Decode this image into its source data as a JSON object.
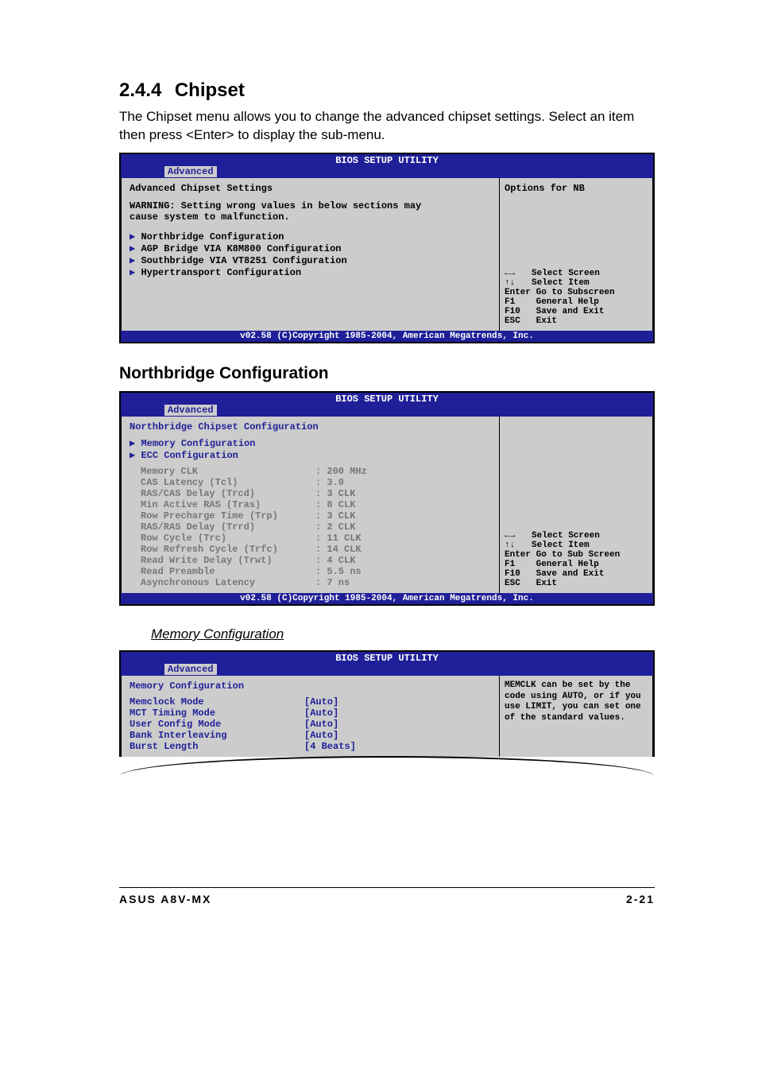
{
  "section": {
    "number": "2.4.4",
    "title": "Chipset"
  },
  "intro": "The Chipset menu allows you to change the advanced chipset settings. Select an item then press <Enter> to display the sub-menu.",
  "bios1": {
    "title": "BIOS SETUP UTILITY",
    "tab": "Advanced",
    "panel_title": "Advanced Chipset Settings",
    "warning1": "WARNING: Setting wrong values in below sections may",
    "warning2": "         cause system to malfunction.",
    "items": [
      "Northbridge Configuration",
      "AGP Bridge VIA K8M800 Configuration",
      "Southbridge VIA VT8251 Configuration",
      "Hypertransport Configuration"
    ],
    "help_top": "Options for NB",
    "nav": {
      "lr": "Select Screen",
      "ud": "Select Item",
      "enter": "Enter Go to Subscreen",
      "f1": "F1    General Help",
      "f10": "F10   Save and Exit",
      "esc": "ESC   Exit"
    },
    "footer": "v02.58 (C)Copyright 1985-2004, American Megatrends, Inc."
  },
  "nb_heading": "Northbridge Configuration",
  "bios2": {
    "title": "BIOS SETUP UTILITY",
    "tab": "Advanced",
    "panel_title": "Northbridge Chipset Configuration",
    "subitems": [
      "Memory Configuration",
      "ECC Configuration"
    ],
    "rows": [
      {
        "k": "Memory CLK",
        "v": ": 200 MHz"
      },
      {
        "k": "CAS Latency (Tcl)",
        "v": ": 3.0"
      },
      {
        "k": "RAS/CAS Delay (Trcd)",
        "v": ": 3 CLK"
      },
      {
        "k": "Min Active RAS (Tras)",
        "v": ": 8 CLK"
      },
      {
        "k": "Row Precharge Time (Trp)",
        "v": ": 3 CLK"
      },
      {
        "k": "RAS/RAS Delay (Trrd)",
        "v": ": 2 CLK"
      },
      {
        "k": "Row Cycle (Trc)",
        "v": ": 11 CLK"
      },
      {
        "k": "Row Refresh Cycle (Trfc)",
        "v": ": 14 CLK"
      },
      {
        "k": "Read Write Delay (Trwt)",
        "v": ": 4 CLK"
      },
      {
        "k": "Read Preamble",
        "v": ": 5.5 ns"
      },
      {
        "k": "Asynchronous Latency",
        "v": ": 7 ns"
      }
    ],
    "nav": {
      "lr": "Select Screen",
      "ud": "Select Item",
      "enter": "Enter Go to Sub Screen",
      "f1": "F1    General Help",
      "f10": "F10   Save and Exit",
      "esc": "ESC   Exit"
    },
    "footer": "v02.58 (C)Copyright 1985-2004, American Megatrends, Inc."
  },
  "mem_heading": "Memory Configuration",
  "bios3": {
    "title": "BIOS SETUP UTILITY",
    "tab": "Advanced",
    "panel_title": "Memory Configuration",
    "rows": [
      {
        "k": "Memclock Mode",
        "v": "[Auto]"
      },
      {
        "k": "MCT Timing Mode",
        "v": "[Auto]"
      },
      {
        "k": "User Config Mode",
        "v": "[Auto]"
      },
      {
        "k": "Bank Interleaving",
        "v": "[Auto]"
      },
      {
        "k": "Burst Length",
        "v": "[4 Beats]"
      }
    ],
    "help_top": "MEMCLK can be set by the code using AUTO, or if you use LIMIT, you can set one of the standard values."
  },
  "footer": {
    "left": "ASUS A8V-MX",
    "right": "2-21"
  }
}
